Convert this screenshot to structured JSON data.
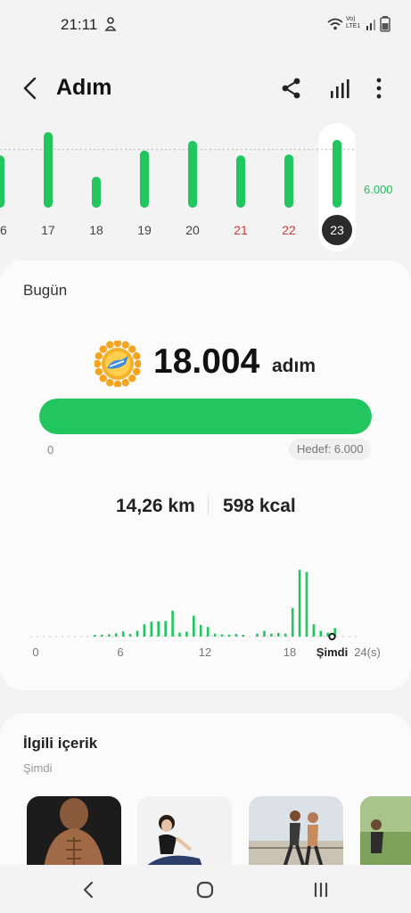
{
  "status_bar": {
    "time": "21:11",
    "network_label": "Vo) LTE1"
  },
  "header": {
    "title": "Adım"
  },
  "week": {
    "days": [
      {
        "label": "16",
        "steps": 5400,
        "weekend": false,
        "selected": false
      },
      {
        "label": "17",
        "steps": 7800,
        "weekend": false,
        "selected": false
      },
      {
        "label": "18",
        "steps": 3200,
        "weekend": false,
        "selected": false
      },
      {
        "label": "19",
        "steps": 5900,
        "weekend": false,
        "selected": false
      },
      {
        "label": "20",
        "steps": 6900,
        "weekend": false,
        "selected": false
      },
      {
        "label": "21",
        "steps": 5400,
        "weekend": true,
        "selected": false
      },
      {
        "label": "22",
        "steps": 5500,
        "weekend": true,
        "selected": false
      },
      {
        "label": "23",
        "steps": 7000,
        "weekend": false,
        "selected": true
      }
    ],
    "goal_label": "6.000",
    "goal_steps": 6000,
    "max_steps": 8000
  },
  "today": {
    "title": "Bugün",
    "steps": "18.004",
    "steps_unit": "adım",
    "progress_fraction": 1.0,
    "progress_min": "0",
    "goal_text": "Hedef: 6.000",
    "distance": "14,26 km",
    "calories": "598 kcal"
  },
  "hourly": {
    "axis_labels": [
      "0",
      "6",
      "12",
      "18",
      "Şimdi",
      "24(s)"
    ],
    "now_hour": 21.0,
    "max_value": 2200,
    "bars": [
      {
        "h": 4.2,
        "v": 40
      },
      {
        "h": 4.7,
        "v": 60
      },
      {
        "h": 5.2,
        "v": 70
      },
      {
        "h": 5.7,
        "v": 100
      },
      {
        "h": 6.2,
        "v": 160
      },
      {
        "h": 6.7,
        "v": 80
      },
      {
        "h": 7.2,
        "v": 180
      },
      {
        "h": 7.7,
        "v": 380
      },
      {
        "h": 8.2,
        "v": 460
      },
      {
        "h": 8.7,
        "v": 470
      },
      {
        "h": 9.2,
        "v": 480
      },
      {
        "h": 9.7,
        "v": 800
      },
      {
        "h": 10.2,
        "v": 120
      },
      {
        "h": 10.7,
        "v": 150
      },
      {
        "h": 11.2,
        "v": 640
      },
      {
        "h": 11.7,
        "v": 360
      },
      {
        "h": 12.2,
        "v": 300
      },
      {
        "h": 12.7,
        "v": 90
      },
      {
        "h": 13.2,
        "v": 70
      },
      {
        "h": 13.7,
        "v": 60
      },
      {
        "h": 14.2,
        "v": 80
      },
      {
        "h": 14.7,
        "v": 50
      },
      {
        "h": 15.7,
        "v": 90
      },
      {
        "h": 16.2,
        "v": 180
      },
      {
        "h": 16.7,
        "v": 90
      },
      {
        "h": 17.2,
        "v": 110
      },
      {
        "h": 17.7,
        "v": 90
      },
      {
        "h": 18.2,
        "v": 880
      },
      {
        "h": 18.7,
        "v": 2060
      },
      {
        "h": 19.2,
        "v": 1990
      },
      {
        "h": 19.7,
        "v": 380
      },
      {
        "h": 20.2,
        "v": 180
      },
      {
        "h": 20.7,
        "v": 120
      },
      {
        "h": 21.2,
        "v": 260
      }
    ]
  },
  "related": {
    "title": "İlgili içerik",
    "subtitle": "Şimdi",
    "items": [
      {
        "name": "abs-workout-thumbnail"
      },
      {
        "name": "stretching-thumbnail"
      },
      {
        "name": "running-couple-thumbnail"
      },
      {
        "name": "outdoor-runner-thumbnail"
      }
    ]
  },
  "colors": {
    "accent_green": "#22c65f",
    "weekend_red": "#d23a3a",
    "background": "#f3f3f3",
    "card": "#fbfbfb"
  }
}
